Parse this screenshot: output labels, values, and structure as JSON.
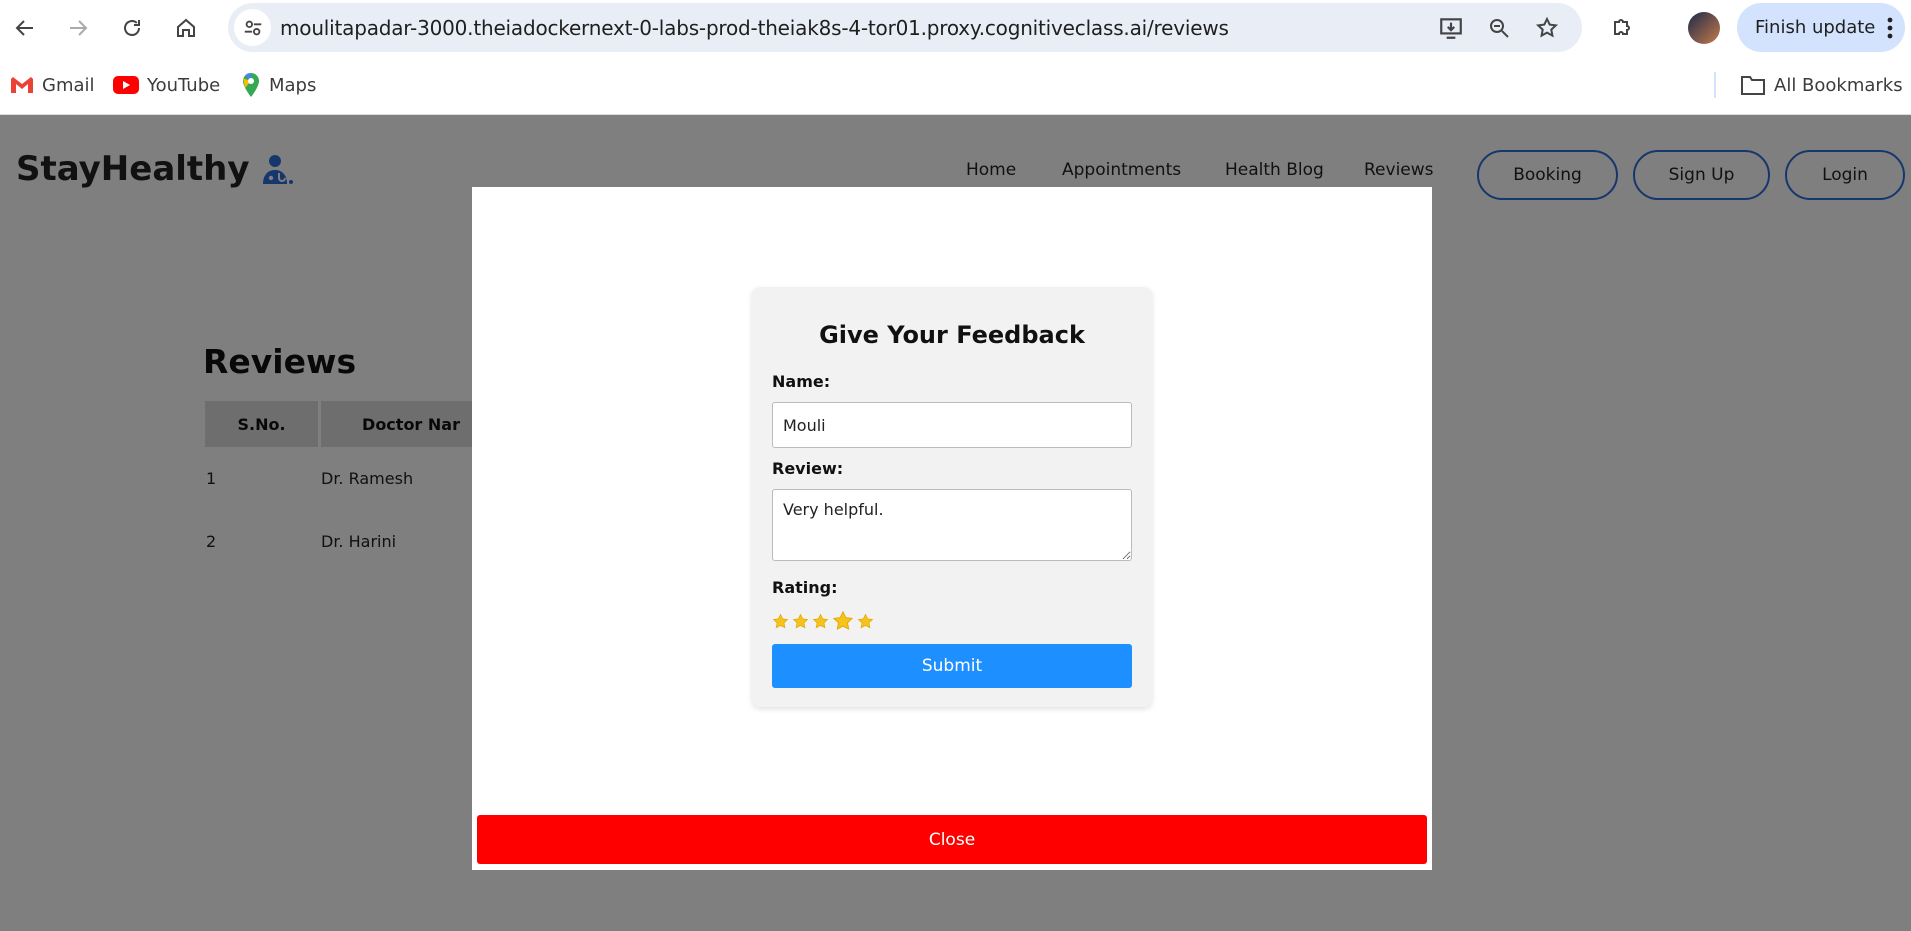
{
  "browser": {
    "url": "moulitapadar-3000.theiadockernext-0-labs-prod-theiak8s-4-tor01.proxy.cognitiveclass.ai/reviews",
    "finish_update_label": "Finish update",
    "bookmarks": [
      {
        "label": "Gmail",
        "icon": "gmail-icon"
      },
      {
        "label": "YouTube",
        "icon": "youtube-icon"
      },
      {
        "label": "Maps",
        "icon": "maps-icon"
      }
    ],
    "all_bookmarks_label": "All Bookmarks"
  },
  "site": {
    "logo_text": "StayHealthy",
    "nav": [
      "Home",
      "Appointments",
      "Health Blog",
      "Reviews"
    ],
    "buttons": [
      "Booking",
      "Sign Up",
      "Login"
    ]
  },
  "reviews": {
    "title": "Reviews",
    "columns": [
      "S.No.",
      "Doctor Nar"
    ],
    "rows": [
      {
        "sno": "1",
        "doctor": "Dr. Ramesh"
      },
      {
        "sno": "2",
        "doctor": "Dr. Harini"
      }
    ]
  },
  "feedback": {
    "title": "Give Your Feedback",
    "name_label": "Name:",
    "name_value": "Mouli",
    "review_label": "Review:",
    "review_value": "Very helpful.",
    "rating_label": "Rating:",
    "rating_value": 4,
    "rating_max": 5,
    "submit_label": "Submit"
  },
  "modal": {
    "close_label": "Close"
  },
  "colors": {
    "accent_blue": "#1e8fff",
    "close_red": "#ff0000",
    "star_gold": "#f6c21c",
    "outline_blue": "#2a6fd6"
  }
}
